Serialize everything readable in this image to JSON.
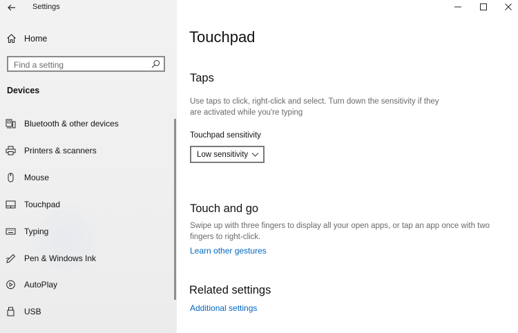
{
  "window": {
    "title": "Settings"
  },
  "sidebar": {
    "home_label": "Home",
    "search_placeholder": "Find a setting",
    "section_header": "Devices",
    "items": [
      {
        "label": "Bluetooth & other devices",
        "icon": "bluetooth-devices-icon"
      },
      {
        "label": "Printers & scanners",
        "icon": "printer-icon"
      },
      {
        "label": "Mouse",
        "icon": "mouse-icon"
      },
      {
        "label": "Touchpad",
        "icon": "touchpad-icon"
      },
      {
        "label": "Typing",
        "icon": "keyboard-icon"
      },
      {
        "label": "Pen & Windows Ink",
        "icon": "pen-icon"
      },
      {
        "label": "AutoPlay",
        "icon": "autoplay-icon"
      },
      {
        "label": "USB",
        "icon": "usb-icon"
      }
    ]
  },
  "main": {
    "page_title": "Touchpad",
    "taps": {
      "heading": "Taps",
      "description": "Use taps to click, right-click and select. Turn down the sensitivity if they are activated while you're typing",
      "sensitivity_label": "Touchpad sensitivity",
      "sensitivity_value": "Low sensitivity"
    },
    "touch_and_go": {
      "heading": "Touch and go",
      "description": "Swipe up with three fingers to display all your open apps, or tap an app once with two fingers to right-click.",
      "link": "Learn other gestures"
    },
    "related": {
      "heading": "Related settings",
      "link": "Additional settings"
    }
  },
  "colors": {
    "accent": "#0067c0",
    "sidebar_bg": "#f0f0f0",
    "secondary_text": "#6a6a6a"
  }
}
